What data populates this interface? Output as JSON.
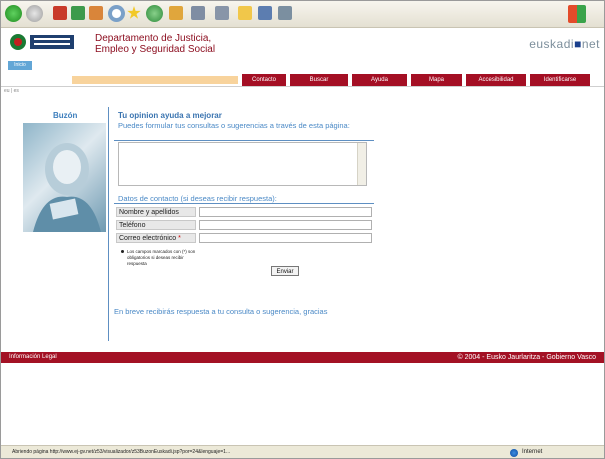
{
  "toolbar": {
    "icons": [
      "back-icon",
      "forward-icon",
      "stop-icon",
      "refresh-icon",
      "home-icon",
      "search-icon",
      "favorites-icon",
      "history-icon",
      "mail-icon",
      "print-icon",
      "edit-icon",
      "messenger-icon",
      "folder-icon",
      "windows-icon"
    ]
  },
  "header": {
    "dept_line1": "Departamento de Justicia,",
    "dept_line2": "Empleo y Seguridad Social",
    "euskadi_prefix": "euskadi",
    "euskadi_suffix": "net",
    "inicio": "Inicio"
  },
  "nav": {
    "items": [
      {
        "label": "Contacto"
      },
      {
        "label": "Buscar"
      },
      {
        "label": "Ayuda"
      },
      {
        "label": "Mapa"
      },
      {
        "label": "Accesibilidad"
      },
      {
        "label": "Identificarse"
      }
    ]
  },
  "breadcrumb": "eu | es",
  "sidebar": {
    "title": "Buzón"
  },
  "form": {
    "title": "Tu opinion ayuda a mejorar",
    "subtitle": "Puedes formular tus consultas o sugerencias a través de esta página:",
    "contact_heading": "Datos de contacto (si deseas recibir respuesta):",
    "fields": [
      {
        "label": "Nombre y apellidos",
        "value": ""
      },
      {
        "label": "Teléfono",
        "value": ""
      },
      {
        "label": "Correo electrónico",
        "required_mark": "*",
        "value": ""
      }
    ],
    "note": "Los campos marcados con (*) son obligatorios si deseas recibir respuesta",
    "send_label": "Enviar",
    "thanks": "En breve recibirás respuesta a tu consulta o sugerencia, gracias"
  },
  "footer": {
    "left": "Información Legal",
    "right": "© 2004 - Eusko Jaurlaritza - Gobierno Vasco"
  },
  "statusbar": {
    "text": "Abriendo página http://www.ej-gv.net/z53/visualizador/z53BuzonEuskadi.jsp?por=24&lenguaje=1...",
    "zone": "Internet"
  },
  "colors": {
    "brand_red": "#a40f24",
    "link_blue": "#4a89c6",
    "accent_yellow": "#f8d39c"
  }
}
